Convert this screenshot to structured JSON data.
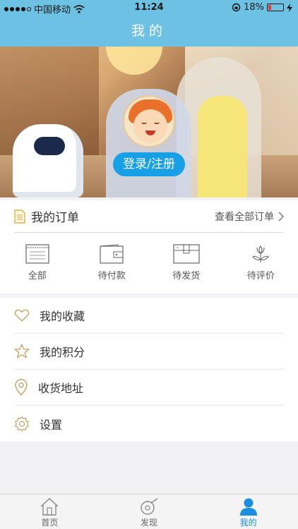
{
  "status": {
    "carrier": "中国移动",
    "time": "11:24",
    "battery": "18%",
    "battery_level": 0.18
  },
  "nav": {
    "title": "我的"
  },
  "hero": {
    "login_label": "登录/注册"
  },
  "orders": {
    "title": "我的订单",
    "view_all": "查看全部订单",
    "items": [
      {
        "label": "全部",
        "icon": "list-doc-icon"
      },
      {
        "label": "待付款",
        "icon": "wallet-icon"
      },
      {
        "label": "待发货",
        "icon": "box-icon"
      },
      {
        "label": "待评价",
        "icon": "flower-icon"
      }
    ]
  },
  "menu": {
    "items": [
      {
        "label": "我的收藏",
        "icon": "heart-icon"
      },
      {
        "label": "我的积分",
        "icon": "star-icon"
      },
      {
        "label": "收货地址",
        "icon": "location-pin-icon"
      },
      {
        "label": "设置",
        "icon": "gear-icon"
      }
    ]
  },
  "tabs": [
    {
      "label": "首页",
      "icon": "home-icon"
    },
    {
      "label": "发现",
      "icon": "discover-icon"
    },
    {
      "label": "我的",
      "icon": "user-icon"
    }
  ],
  "colors": {
    "nav": "#6dc2e4",
    "accent": "#18a0e6",
    "icon_gold": "#c9a66b",
    "tab_active": "#1a8fe0"
  }
}
